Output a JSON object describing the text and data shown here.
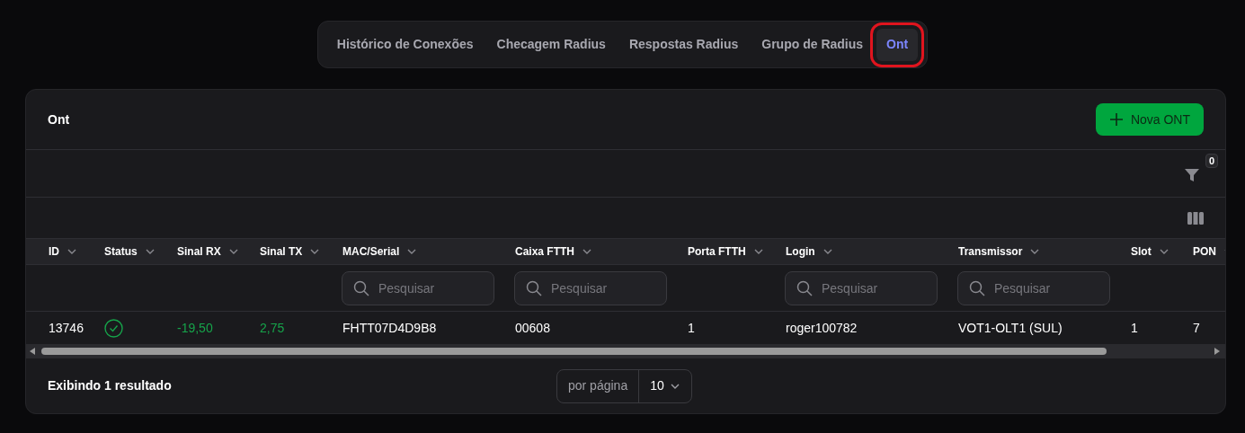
{
  "tabs": [
    {
      "label": "Histórico de Conexões",
      "selected": false,
      "highlighted": false
    },
    {
      "label": "Checagem Radius",
      "selected": false,
      "highlighted": false
    },
    {
      "label": "Respostas Radius",
      "selected": false,
      "highlighted": false
    },
    {
      "label": "Grupo de Radius",
      "selected": false,
      "highlighted": false
    },
    {
      "label": "Ont",
      "selected": true,
      "highlighted": true
    }
  ],
  "card": {
    "title": "Ont",
    "new_button": "Nova ONT",
    "filter_count": "0"
  },
  "table": {
    "columns": [
      {
        "label": "ID",
        "search": false
      },
      {
        "label": "Status",
        "search": false
      },
      {
        "label": "Sinal RX",
        "search": false
      },
      {
        "label": "Sinal TX",
        "search": false
      },
      {
        "label": "MAC/Serial",
        "search": true,
        "placeholder": "Pesquisar"
      },
      {
        "label": "Caixa FTTH",
        "search": true,
        "placeholder": "Pesquisar"
      },
      {
        "label": "Porta FTTH",
        "search": false
      },
      {
        "label": "Login",
        "search": true,
        "placeholder": "Pesquisar"
      },
      {
        "label": "Transmissor",
        "search": true,
        "placeholder": "Pesquisar"
      },
      {
        "label": "Slot",
        "search": false
      },
      {
        "label": "PON",
        "search": false
      }
    ],
    "rows": [
      {
        "cells": [
          {
            "kind": "text",
            "text": "13746"
          },
          {
            "kind": "status",
            "ok": true
          },
          {
            "kind": "signal",
            "text": "-19,50"
          },
          {
            "kind": "signal",
            "text": "2,75"
          },
          {
            "kind": "text",
            "text": "FHTT07D4D9B8"
          },
          {
            "kind": "text",
            "text": "00608"
          },
          {
            "kind": "text",
            "text": "1"
          },
          {
            "kind": "text",
            "text": "roger100782"
          },
          {
            "kind": "text",
            "text": "VOT1-OLT1 (SUL)"
          },
          {
            "kind": "text",
            "text": "1"
          },
          {
            "kind": "text",
            "text": "7"
          }
        ]
      }
    ]
  },
  "footer": {
    "summary": "Exibindo 1 resultado",
    "per_page_label": "por página",
    "per_page": "10"
  }
}
